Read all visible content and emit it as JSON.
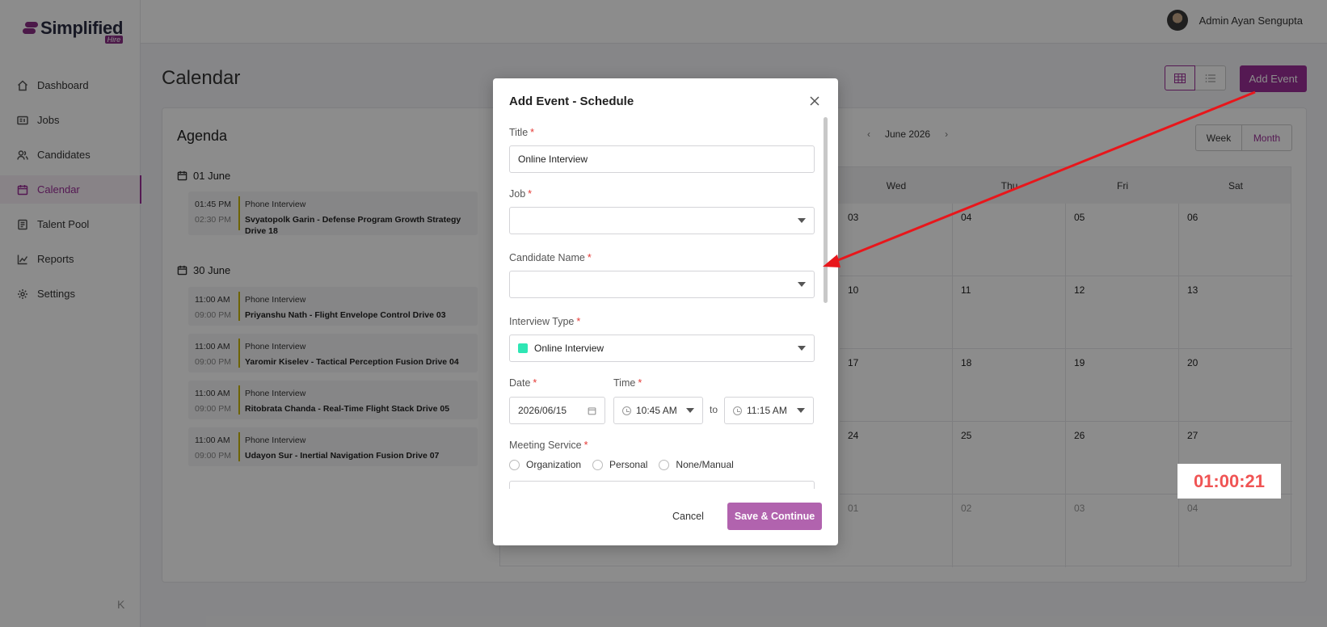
{
  "brand": {
    "name": "Simplified",
    "tag": "Hire"
  },
  "sidebar": {
    "items": [
      {
        "label": "Dashboard",
        "icon": "home-icon"
      },
      {
        "label": "Jobs",
        "icon": "id-card-icon"
      },
      {
        "label": "Candidates",
        "icon": "users-icon"
      },
      {
        "label": "Calendar",
        "icon": "calendar-icon",
        "active": true
      },
      {
        "label": "Talent Pool",
        "icon": "document-icon"
      },
      {
        "label": "Reports",
        "icon": "chart-icon"
      },
      {
        "label": "Settings",
        "icon": "gear-icon"
      }
    ],
    "collapse_glyph": "K"
  },
  "header": {
    "user_name": "Admin Ayan Sengupta"
  },
  "page": {
    "title": "Calendar",
    "add_event_label": "Add Event"
  },
  "agenda": {
    "title": "Agenda",
    "groups": [
      {
        "date": "01 June",
        "events": [
          {
            "start": "01:45 PM",
            "end": "02:30 PM",
            "type": "Phone Interview",
            "name": "Svyatopolk Garin - Defense Program Growth Strategy Drive 18"
          }
        ]
      },
      {
        "date": "30 June",
        "events": [
          {
            "start": "11:00 AM",
            "end": "09:00 PM",
            "type": "Phone Interview",
            "name": "Priyanshu Nath - Flight Envelope Control Drive 03"
          },
          {
            "start": "11:00 AM",
            "end": "09:00 PM",
            "type": "Phone Interview",
            "name": "Yaromir Kiselev - Tactical Perception Fusion Drive 04"
          },
          {
            "start": "11:00 AM",
            "end": "09:00 PM",
            "type": "Phone Interview",
            "name": "Ritobrata Chanda - Real-Time Flight Stack Drive 05"
          },
          {
            "start": "11:00 AM",
            "end": "09:00 PM",
            "type": "Phone Interview",
            "name": "Udayon Sur - Inertial Navigation Fusion Drive 07"
          }
        ]
      }
    ]
  },
  "calendar": {
    "month_label": "June 2026",
    "prev_glyph": "‹",
    "next_glyph": "›",
    "week_label": "Week",
    "month_btn_label": "Month",
    "visible_day_headers": [
      "Wed",
      "Thu",
      "Fri",
      "Sat"
    ],
    "rows": [
      [
        "03",
        "04",
        "05",
        "06"
      ],
      [
        "10",
        "11",
        "12",
        "13"
      ],
      [
        "17",
        "18",
        "19",
        "20"
      ],
      [
        "24",
        "25",
        "26",
        "27"
      ],
      [
        "01",
        "02",
        "03",
        "04"
      ]
    ]
  },
  "modal": {
    "title": "Add Event - Schedule",
    "title_label": "Title",
    "title_value": "Online Interview",
    "job_label": "Job",
    "candidate_label": "Candidate Name",
    "interview_type_label": "Interview Type",
    "interview_type_value": "Online Interview",
    "interview_type_color": "#2ee6b4",
    "date_label": "Date",
    "date_value": "2026/06/15",
    "time_label": "Time",
    "time_start": "10:45 AM",
    "time_to": "to",
    "time_end": "11:15 AM",
    "meeting_label": "Meeting Service",
    "meeting_options": [
      "Organization",
      "Personal",
      "None/Manual"
    ],
    "required_mark": "*",
    "cancel_label": "Cancel",
    "save_label": "Save & Continue"
  },
  "annotation": {
    "timer": "01:00:21",
    "arrow_color": "#e8161b"
  },
  "colors": {
    "accent": "#9b2f97",
    "save_button": "#b163ae"
  }
}
